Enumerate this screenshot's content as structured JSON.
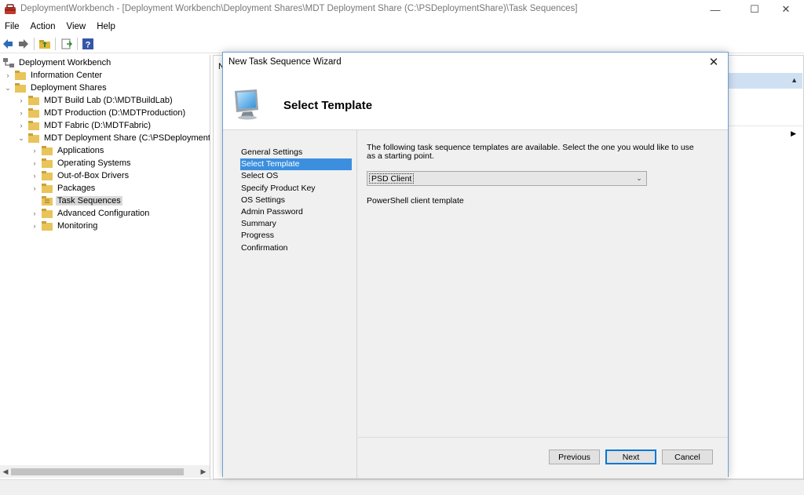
{
  "window": {
    "title": "DeploymentWorkbench - [Deployment Workbench\\Deployment Shares\\MDT Deployment Share (C:\\PSDeploymentShare)\\Task Sequences]",
    "minimize": "—",
    "maximize": "☐",
    "close": "✕"
  },
  "menu": [
    "File",
    "Action",
    "View",
    "Help"
  ],
  "tree": [
    {
      "label": "Deployment Workbench",
      "level": 0,
      "expander": ""
    },
    {
      "label": "Information Center",
      "level": 1,
      "expander": "›"
    },
    {
      "label": "Deployment Shares",
      "level": 1,
      "expander": "⌄"
    },
    {
      "label": "MDT Build Lab (D:\\MDTBuildLab)",
      "level": 2,
      "expander": "›"
    },
    {
      "label": "MDT Production (D:\\MDTProduction)",
      "level": 2,
      "expander": "›"
    },
    {
      "label": "MDT Fabric (D:\\MDTFabric)",
      "level": 2,
      "expander": "›"
    },
    {
      "label": "MDT Deployment Share (C:\\PSDeploymentSh",
      "level": 2,
      "expander": "⌄"
    },
    {
      "label": "Applications",
      "level": 3,
      "expander": "›"
    },
    {
      "label": "Operating Systems",
      "level": 3,
      "expander": "›"
    },
    {
      "label": "Out-of-Box Drivers",
      "level": 3,
      "expander": "›"
    },
    {
      "label": "Packages",
      "level": 3,
      "expander": "›"
    },
    {
      "label": "Task Sequences",
      "level": 3,
      "expander": "",
      "selected": true
    },
    {
      "label": "Advanced Configuration",
      "level": 3,
      "expander": "›"
    },
    {
      "label": "Monitoring",
      "level": 3,
      "expander": "›"
    }
  ],
  "result_pane": {
    "header_partial": "N"
  },
  "dialog": {
    "title": "New Task Sequence Wizard",
    "close": "✕",
    "header": "Select Template",
    "steps": [
      "General Settings",
      "Select Template",
      "Select OS",
      "Specify Product Key",
      "OS Settings",
      "Admin Password",
      "Summary",
      "Progress",
      "Confirmation"
    ],
    "active_step": 1,
    "description": "The following task sequence templates are available.  Select the one you would like to use as a starting point.",
    "template_select": {
      "value": "PSD Client"
    },
    "template_description": "PowerShell client template",
    "buttons": {
      "previous": "Previous",
      "next": "Next",
      "cancel": "Cancel"
    }
  },
  "colors": {
    "selection": "#3b8fde",
    "dialog_border": "#6aa0d6",
    "default_button": "#0078d7",
    "panel_bg": "#f0f0f0"
  },
  "icons": {
    "app": "deployment-workbench-icon",
    "wizard": "computer-monitor-icon"
  }
}
